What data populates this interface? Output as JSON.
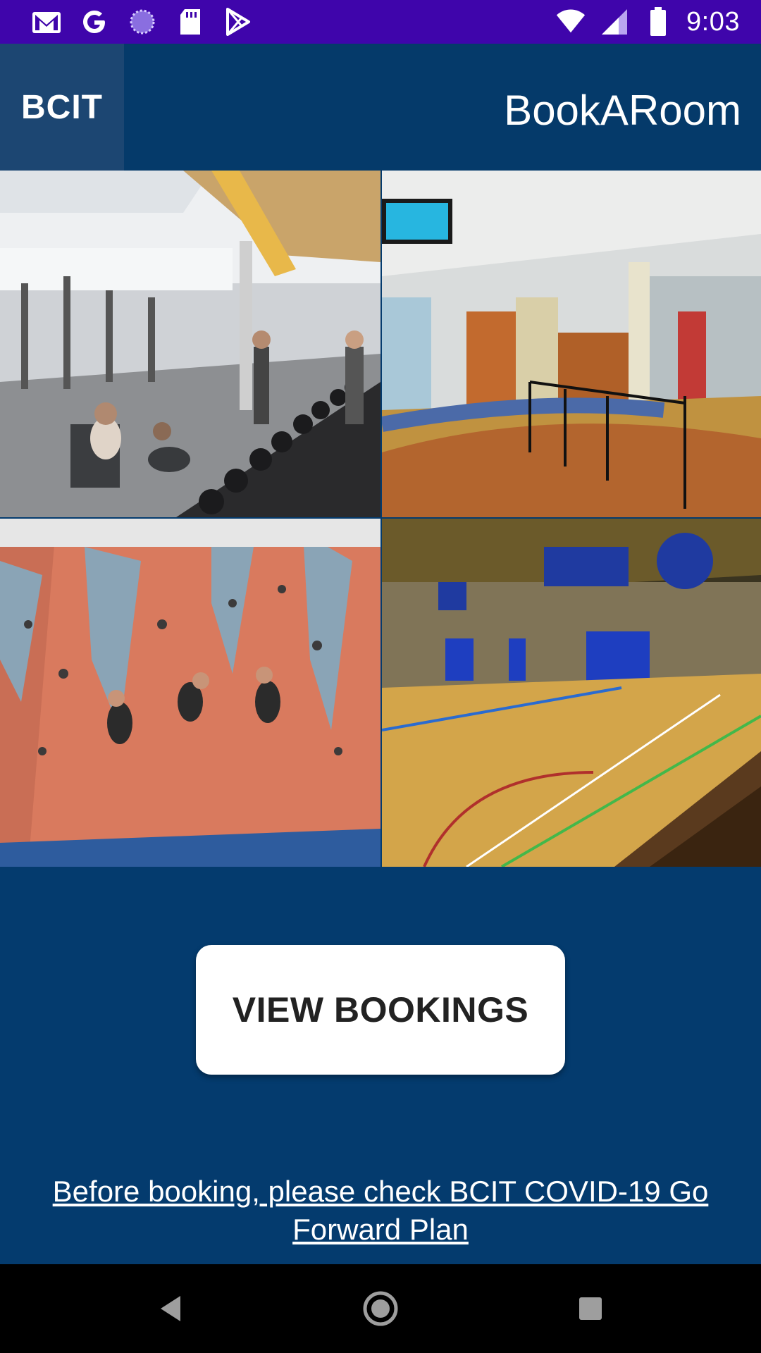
{
  "status_bar": {
    "time": "9:03",
    "left_icons": [
      "gmail-icon",
      "google-icon",
      "sync-icon",
      "sd-card-icon",
      "play-store-icon"
    ],
    "right_icons": [
      "wifi-icon",
      "cellular-signal-icon",
      "battery-icon"
    ],
    "background": "#3f05ab"
  },
  "app_bar": {
    "logo": "BCIT",
    "title": "BookARoom",
    "background": "#053a6a"
  },
  "facilities": [
    {
      "id": "gym",
      "image": "gym-photo"
    },
    {
      "id": "office",
      "image": "office-photo"
    },
    {
      "id": "climbing",
      "image": "climbing-wall-photo"
    },
    {
      "id": "court",
      "image": "gymnasium-court-photo"
    }
  ],
  "main": {
    "view_bookings_label": "VIEW BOOKINGS",
    "covid_link_text": "Before booking, please check BCIT COVID-19 Go Forward Plan",
    "background": "#043b6e"
  },
  "nav_bar": {
    "buttons": [
      "back-icon",
      "home-icon",
      "recents-icon"
    ]
  }
}
